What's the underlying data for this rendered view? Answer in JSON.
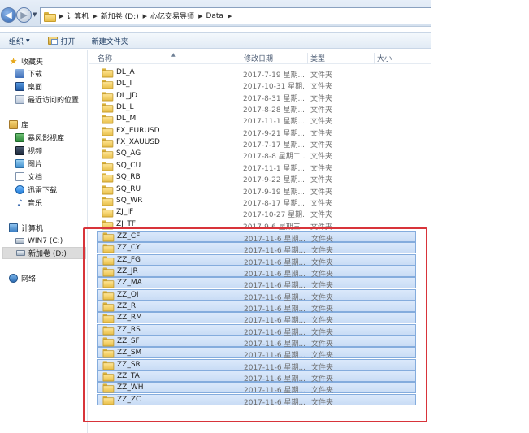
{
  "address_bar": {
    "breadcrumbs": [
      "计算机",
      "新加卷 (D:)",
      "心亿交易导师",
      "Data"
    ]
  },
  "toolbar": {
    "organize": "组织",
    "open": "打开",
    "new_folder": "新建文件夹"
  },
  "nav": {
    "favorites": "收藏夹",
    "downloads": "下载",
    "desktop": "桌面",
    "recent": "最近访问的位置",
    "libraries": "库",
    "storm_video": "暴风影视库",
    "videos": "视频",
    "pictures": "图片",
    "documents": "文档",
    "thunder": "迅雷下载",
    "music": "音乐",
    "computer": "计算机",
    "drive_c": "WIN7 (C:)",
    "drive_d": "新加卷 (D:)",
    "network": "网络"
  },
  "columns": {
    "name": "名称",
    "date": "修改日期",
    "type": "类型",
    "size": "大小"
  },
  "files": [
    {
      "name": "DL_A",
      "date": "2017-7-19 星期...",
      "type": "文件夹",
      "selected": false
    },
    {
      "name": "DL_I",
      "date": "2017-10-31 星期...",
      "type": "文件夹",
      "selected": false
    },
    {
      "name": "DL_JD",
      "date": "2017-8-31 星期...",
      "type": "文件夹",
      "selected": false
    },
    {
      "name": "DL_L",
      "date": "2017-8-28 星期...",
      "type": "文件夹",
      "selected": false
    },
    {
      "name": "DL_M",
      "date": "2017-11-1 星期...",
      "type": "文件夹",
      "selected": false
    },
    {
      "name": "FX_EURUSD",
      "date": "2017-9-21 星期...",
      "type": "文件夹",
      "selected": false
    },
    {
      "name": "FX_XAUUSD",
      "date": "2017-7-17 星期...",
      "type": "文件夹",
      "selected": false
    },
    {
      "name": "SQ_AG",
      "date": "2017-8-8 星期二 ...",
      "type": "文件夹",
      "selected": false
    },
    {
      "name": "SQ_CU",
      "date": "2017-11-1 星期...",
      "type": "文件夹",
      "selected": false
    },
    {
      "name": "SQ_RB",
      "date": "2017-9-22 星期...",
      "type": "文件夹",
      "selected": false
    },
    {
      "name": "SQ_RU",
      "date": "2017-9-19 星期...",
      "type": "文件夹",
      "selected": false
    },
    {
      "name": "SQ_WR",
      "date": "2017-8-17 星期...",
      "type": "文件夹",
      "selected": false
    },
    {
      "name": "ZJ_IF",
      "date": "2017-10-27 星期...",
      "type": "文件夹",
      "selected": false
    },
    {
      "name": "ZJ_TF",
      "date": "2017-9-6 星期三 ...",
      "type": "文件夹",
      "selected": false
    },
    {
      "name": "ZZ_CF",
      "date": "2017-11-6 星期...",
      "type": "文件夹",
      "selected": true
    },
    {
      "name": "ZZ_CY",
      "date": "2017-11-6 星期...",
      "type": "文件夹",
      "selected": true
    },
    {
      "name": "ZZ_FG",
      "date": "2017-11-6 星期...",
      "type": "文件夹",
      "selected": true
    },
    {
      "name": "ZZ_JR",
      "date": "2017-11-6 星期...",
      "type": "文件夹",
      "selected": true
    },
    {
      "name": "ZZ_MA",
      "date": "2017-11-6 星期...",
      "type": "文件夹",
      "selected": true
    },
    {
      "name": "ZZ_OI",
      "date": "2017-11-6 星期...",
      "type": "文件夹",
      "selected": true
    },
    {
      "name": "ZZ_RI",
      "date": "2017-11-6 星期...",
      "type": "文件夹",
      "selected": true
    },
    {
      "name": "ZZ_RM",
      "date": "2017-11-6 星期...",
      "type": "文件夹",
      "selected": true
    },
    {
      "name": "ZZ_RS",
      "date": "2017-11-6 星期...",
      "type": "文件夹",
      "selected": true
    },
    {
      "name": "ZZ_SF",
      "date": "2017-11-6 星期...",
      "type": "文件夹",
      "selected": true
    },
    {
      "name": "ZZ_SM",
      "date": "2017-11-6 星期...",
      "type": "文件夹",
      "selected": true
    },
    {
      "name": "ZZ_SR",
      "date": "2017-11-6 星期...",
      "type": "文件夹",
      "selected": true
    },
    {
      "name": "ZZ_TA",
      "date": "2017-11-6 星期...",
      "type": "文件夹",
      "selected": true
    },
    {
      "name": "ZZ_WH",
      "date": "2017-11-6 星期...",
      "type": "文件夹",
      "selected": true
    },
    {
      "name": "ZZ_ZC",
      "date": "2017-11-6 星期...",
      "type": "文件夹",
      "selected": true
    }
  ],
  "colors": {
    "selection_bg": "#cfe0f7",
    "selection_border": "#84acdd",
    "annotation_box": "#d8343a"
  }
}
